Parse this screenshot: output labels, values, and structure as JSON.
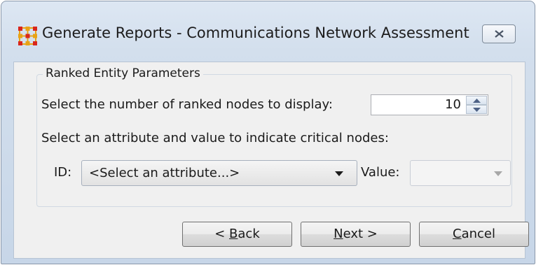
{
  "window": {
    "title": "Generate Reports - Communications Network Assessment"
  },
  "group": {
    "legend": "Ranked Entity Parameters",
    "ranked_nodes_label": "Select the number of ranked nodes to display:",
    "ranked_nodes_value": "10",
    "critical_nodes_label": "Select an attribute and value to indicate critical nodes:",
    "id_label": "ID:",
    "attribute_selected": "<Select an attribute...>",
    "value_label": "Value:",
    "value_selected": ""
  },
  "buttons": {
    "back": {
      "prefix": "< ",
      "mnemonic": "B",
      "rest": "ack"
    },
    "next": {
      "prefix": "",
      "mnemonic": "N",
      "rest": "ext >"
    },
    "cancel": {
      "prefix": "",
      "mnemonic": "C",
      "rest": "ancel"
    }
  },
  "icons": {
    "app": "network-grid-icon",
    "close": "close-icon",
    "spin_up": "arrow-up-icon",
    "spin_down": "arrow-down-icon",
    "dropdown": "chevron-down-icon"
  },
  "colors": {
    "app_icon": "#e8a316",
    "window_frame": "#c7d6e8",
    "dialog_bg": "#f0f0f0"
  }
}
